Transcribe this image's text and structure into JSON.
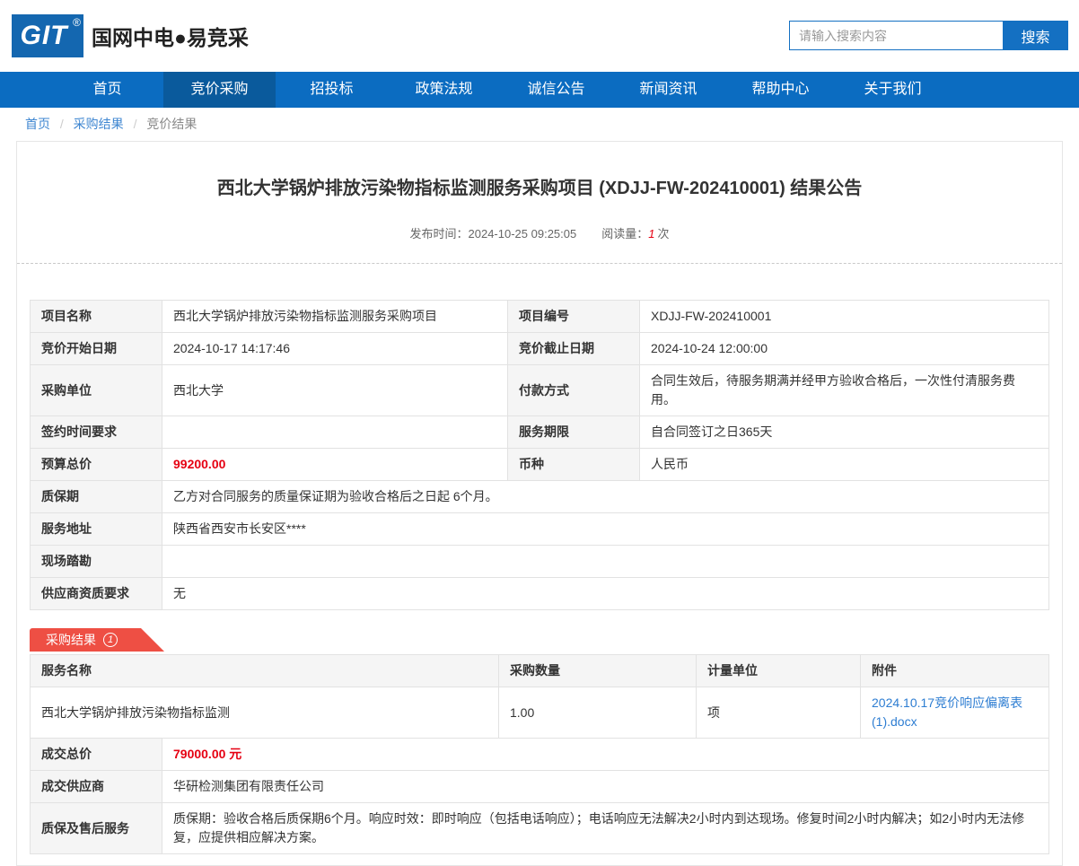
{
  "header": {
    "logo_text": "GIT",
    "logo_reg": "®",
    "site_name": "国网中电●易竞采",
    "search": {
      "placeholder": "请输入搜索内容",
      "button_label": "搜索"
    }
  },
  "nav": {
    "items": [
      {
        "label": "首页"
      },
      {
        "label": "竞价采购",
        "active": true
      },
      {
        "label": "招投标"
      },
      {
        "label": "政策法规"
      },
      {
        "label": "诚信公告"
      },
      {
        "label": "新闻资讯"
      },
      {
        "label": "帮助中心"
      },
      {
        "label": "关于我们"
      }
    ]
  },
  "breadcrumb": {
    "separator": "/",
    "items": [
      {
        "label": "首页"
      },
      {
        "label": "采购结果"
      },
      {
        "label": "竞价结果"
      }
    ]
  },
  "article": {
    "title": "西北大学锅炉排放污染物指标监测服务采购项目 (XDJJ-FW-202410001) 结果公告",
    "publish_label": "发布时间：",
    "publish_time": "2024-10-25 09:25:05",
    "views_label": "阅读量：",
    "views_count": "1",
    "views_unit": "次"
  },
  "info_table": {
    "rows": [
      {
        "l1": "项目名称",
        "v1": "西北大学锅炉排放污染物指标监测服务采购项目",
        "l2": "项目编号",
        "v2": "XDJJ-FW-202410001"
      },
      {
        "l1": "竞价开始日期",
        "v1": "2024-10-17 14:17:46",
        "l2": "竞价截止日期",
        "v2": "2024-10-24 12:00:00"
      },
      {
        "l1": "采购单位",
        "v1": "西北大学",
        "l2": "付款方式",
        "v2": "合同生效后，待服务期满并经甲方验收合格后，一次性付清服务费用。"
      },
      {
        "l1": "签约时间要求",
        "v1": "",
        "l2": "服务期限",
        "v2": "自合同签订之日365天"
      },
      {
        "l1": "预算总价",
        "v1": "99200.00",
        "l2": "币种",
        "v2": "人民币"
      }
    ],
    "full_rows": [
      {
        "label": "质保期",
        "value": "乙方对合同服务的质量保证期为验收合格后之日起 6个月。"
      },
      {
        "label": "服务地址",
        "value": "陕西省西安市长安区****"
      },
      {
        "label": "现场踏勘",
        "value": ""
      },
      {
        "label": "供应商资质要求",
        "value": "无"
      }
    ]
  },
  "result_section": {
    "badge": {
      "label": "采购结果",
      "count": "1"
    },
    "table_headers": [
      "服务名称",
      "采购数量",
      "计量单位",
      "附件"
    ],
    "item": {
      "name": "西北大学锅炉排放污染物指标监测",
      "quantity": "1.00",
      "unit": "项",
      "attachment": "2024.10.17竞价响应偏离表(1).docx"
    },
    "deal": [
      {
        "label": "成交总价",
        "value": "79000.00 元"
      },
      {
        "label": "成交供应商",
        "value": "华研检测集团有限责任公司"
      },
      {
        "label": "质保及售后服务",
        "value": "质保期：验收合格后质保期6个月。响应时效：即时响应（包括电话响应）；电话响应无法解决2小时内到达现场。修复时间2小时内解决；如2小时内无法修复，应提供相应解决方案。"
      }
    ]
  },
  "colors": {
    "nav_blue": "#0b6cc1",
    "nav_active_blue": "#0a5a9c",
    "logo_blue": "#1467b0",
    "search_blue": "#1470c2",
    "badge_red": "#ee4f44",
    "price_red": "#e60012",
    "link_blue": "#2d7dd2"
  }
}
